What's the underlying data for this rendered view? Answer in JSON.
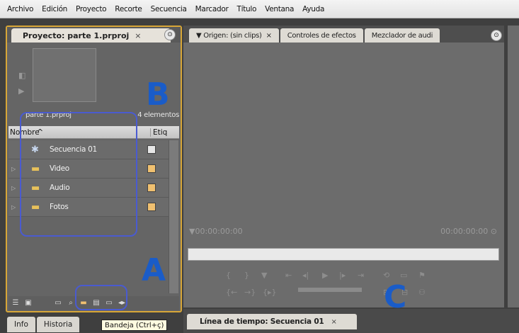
{
  "menu": [
    "Archivo",
    "Edición",
    "Proyecto",
    "Recorte",
    "Secuencia",
    "Marcador",
    "Título",
    "Ventana",
    "Ayuda"
  ],
  "project": {
    "tab_label": "Proyecto: parte 1.prproj",
    "close_glyph": "×",
    "menu_glyph": "⊙",
    "file_name": "parte 1.prproj",
    "item_count": "4 elementos",
    "col_name": "Nombre",
    "col_sort": "^",
    "col_label": "Etiq",
    "items": [
      {
        "name": "Secuencia 01",
        "icon": "sequence-icon",
        "swatch": "#e6e6e6"
      },
      {
        "name": "Video",
        "icon": "folder-icon",
        "swatch": "#f0c070"
      },
      {
        "name": "Audio",
        "icon": "folder-icon",
        "swatch": "#f0c070"
      },
      {
        "name": "Fotos",
        "icon": "folder-icon",
        "swatch": "#f0c070"
      }
    ]
  },
  "annotations": {
    "a": "A",
    "b": "B",
    "c": "C"
  },
  "bottom_tabs": [
    "Info",
    "Historia"
  ],
  "tooltip": "Bandeja (Ctrl+ç)",
  "source": {
    "tabs": [
      {
        "label": "▼ Origen: (sin clips)",
        "close": "×"
      },
      {
        "label": "Controles de efectos",
        "close": ""
      },
      {
        "label": "Mezclador de audi",
        "close": ""
      }
    ],
    "timecode_left": "▼00:00:00:00",
    "timecode_right": "00:00:00:00 ⊙"
  },
  "timeline": {
    "tab_label": "Línea de tiempo: Secuencia 01",
    "close": "×"
  }
}
